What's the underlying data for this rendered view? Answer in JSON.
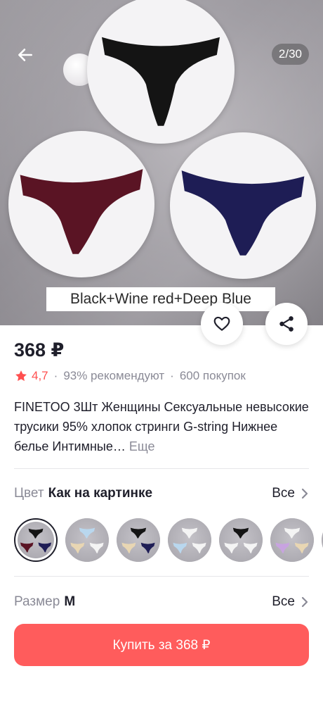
{
  "gallery": {
    "counter": "2/30",
    "caption": "Black+Wine red+Deep Blue",
    "colors": {
      "black": "#141414",
      "wine": "#5a1424",
      "blue": "#1e1d55"
    }
  },
  "product": {
    "price": "368 ₽",
    "rating": "4,7",
    "recommend": "93% рекомендуют",
    "purchases": "600 покупок",
    "title": "FINETOO 3Шт Женщины Сексуальные невысокие трусики 95% хлопок стринги G-string Нижнее белье Интимные…",
    "more_label": "Еще"
  },
  "color_option": {
    "label": "Цвет",
    "value": "Как на картинке",
    "all_label": "Все"
  },
  "size_option": {
    "label": "Размер",
    "value": "M",
    "all_label": "Все"
  },
  "buy_button": {
    "label": "Купить за 368 ₽",
    "color": "#ff5c5c"
  },
  "icons": {
    "back": "arrow-left-icon",
    "favorite": "heart-icon",
    "share": "share-icon",
    "rating": "star-icon",
    "chevron": "chevron-right-icon"
  }
}
